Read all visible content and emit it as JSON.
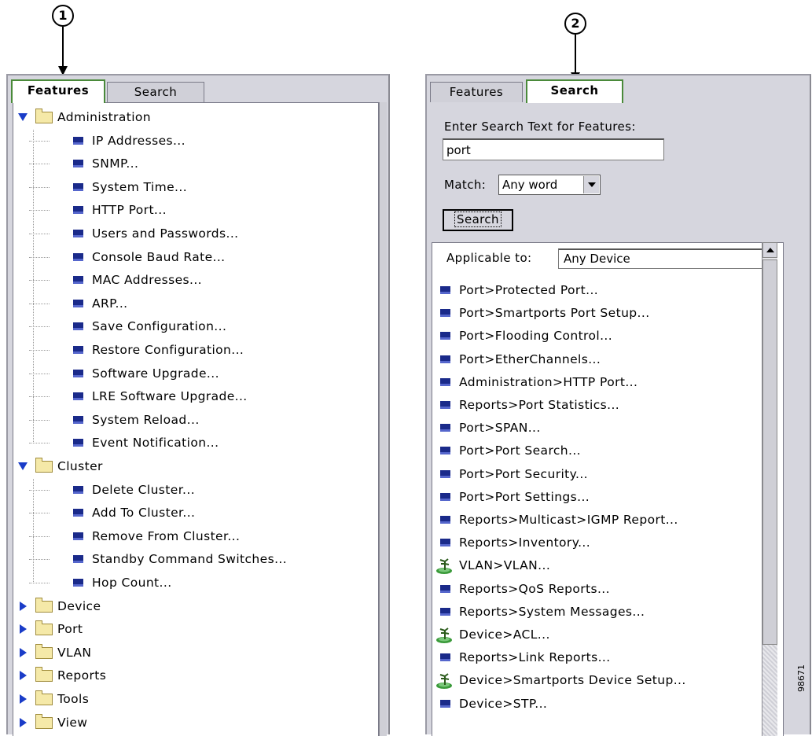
{
  "callouts": [
    "1",
    "2"
  ],
  "figure_id": "98671",
  "left_panel": {
    "tabs": [
      {
        "label": "Features",
        "active": true
      },
      {
        "label": "Search",
        "active": false
      }
    ],
    "tree": [
      {
        "type": "folder",
        "expanded": true,
        "label": "Administration"
      },
      {
        "type": "leaf",
        "label": "IP Addresses..."
      },
      {
        "type": "leaf",
        "label": "SNMP..."
      },
      {
        "type": "leaf",
        "label": "System Time..."
      },
      {
        "type": "leaf",
        "label": "HTTP Port..."
      },
      {
        "type": "leaf",
        "label": "Users and Passwords..."
      },
      {
        "type": "leaf",
        "label": "Console Baud Rate..."
      },
      {
        "type": "leaf",
        "label": "MAC Addresses..."
      },
      {
        "type": "leaf",
        "label": "ARP..."
      },
      {
        "type": "leaf",
        "label": "Save Configuration..."
      },
      {
        "type": "leaf",
        "label": "Restore Configuration..."
      },
      {
        "type": "leaf",
        "label": "Software Upgrade..."
      },
      {
        "type": "leaf",
        "label": "LRE Software Upgrade..."
      },
      {
        "type": "leaf",
        "label": "System Reload..."
      },
      {
        "type": "leaf",
        "label": "Event Notification..."
      },
      {
        "type": "folder",
        "expanded": true,
        "label": "Cluster"
      },
      {
        "type": "leaf",
        "label": "Delete Cluster..."
      },
      {
        "type": "leaf",
        "label": "Add To Cluster..."
      },
      {
        "type": "leaf",
        "label": "Remove From Cluster..."
      },
      {
        "type": "leaf",
        "label": "Standby Command Switches..."
      },
      {
        "type": "leaf",
        "label": "Hop Count..."
      },
      {
        "type": "folder",
        "expanded": false,
        "label": "Device"
      },
      {
        "type": "folder",
        "expanded": false,
        "label": "Port"
      },
      {
        "type": "folder",
        "expanded": false,
        "label": "VLAN"
      },
      {
        "type": "folder",
        "expanded": false,
        "label": "Reports"
      },
      {
        "type": "folder",
        "expanded": false,
        "label": "Tools"
      },
      {
        "type": "folder",
        "expanded": false,
        "label": "View"
      }
    ]
  },
  "right_panel": {
    "tabs": [
      {
        "label": "Features",
        "active": false
      },
      {
        "label": "Search",
        "active": true
      }
    ],
    "prompt_label": "Enter Search Text for Features:",
    "search_value": "port",
    "match_label": "Match:",
    "match_value": "Any word",
    "search_button": "Search",
    "applicable_label": "Applicable to:",
    "applicable_value": "Any Device",
    "results": [
      {
        "label": "Port>Protected Port...",
        "icon": "feature-icon"
      },
      {
        "label": "Port>Smartports Port Setup...",
        "icon": "feature-icon"
      },
      {
        "label": "Port>Flooding Control...",
        "icon": "feature-icon"
      },
      {
        "label": "Port>EtherChannels...",
        "icon": "feature-icon"
      },
      {
        "label": "Administration>HTTP Port...",
        "icon": "feature-icon"
      },
      {
        "label": "Reports>Port Statistics...",
        "icon": "feature-icon"
      },
      {
        "label": "Port>SPAN...",
        "icon": "feature-icon"
      },
      {
        "label": "Port>Port Search...",
        "icon": "feature-icon"
      },
      {
        "label": "Port>Port Security...",
        "icon": "feature-icon"
      },
      {
        "label": "Port>Port Settings...",
        "icon": "feature-icon"
      },
      {
        "label": "Reports>Multicast>IGMP Report...",
        "icon": "feature-icon"
      },
      {
        "label": "Reports>Inventory...",
        "icon": "feature-icon"
      },
      {
        "label": "VLAN>VLAN...",
        "icon": "wizard-icon"
      },
      {
        "label": "Reports>QoS Reports...",
        "icon": "feature-icon"
      },
      {
        "label": "Reports>System Messages...",
        "icon": "feature-icon"
      },
      {
        "label": "Device>ACL...",
        "icon": "wizard-icon"
      },
      {
        "label": "Reports>Link Reports...",
        "icon": "feature-icon"
      },
      {
        "label": "Device>Smartports Device Setup...",
        "icon": "wizard-icon"
      },
      {
        "label": "Device>STP...",
        "icon": "feature-icon"
      }
    ]
  }
}
